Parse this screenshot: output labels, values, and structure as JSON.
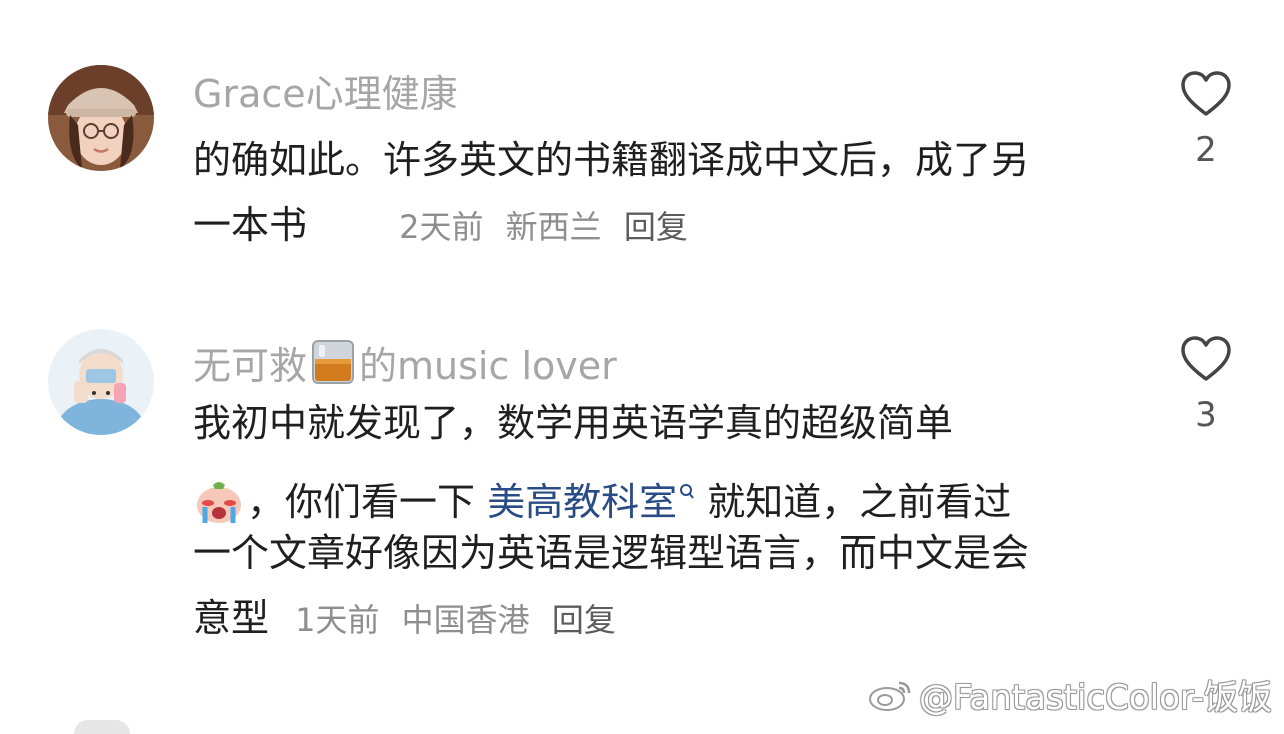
{
  "comments": [
    {
      "author": "Grace心理健康",
      "lines": [
        "的确如此。许多英文的书籍翻译成中文后，成了另",
        "一本书"
      ],
      "time": "2天前",
      "location": "新西兰",
      "reply": "回复",
      "likes": "2",
      "avatar_icon": "woman-avatar"
    },
    {
      "author_prefix": "无可救",
      "author_emoji": "whiskey-glass-icon",
      "author_suffix": "的music lover",
      "line1": "我初中就发现了，数学用英语学真的超级简单",
      "line2_after_emoji": "，你们看一下 ",
      "link": "美高教科室",
      "line2_after_link": " 就知道，之前看过",
      "line3": "一个文章好像因为英语是逻辑型语言，而中文是会",
      "line4": "意型",
      "time": "1天前",
      "location": "中国香港",
      "reply": "回复",
      "likes": "3",
      "avatar_icon": "cartoon-avatar",
      "inline_emoji": "crying-face-icon"
    }
  ],
  "watermark": "@FantasticColor-饭饭",
  "colors": {
    "author": "#a6a6a6",
    "body": "#1f1f1f",
    "meta": "#8e8e8e",
    "link": "#2a4c86"
  }
}
